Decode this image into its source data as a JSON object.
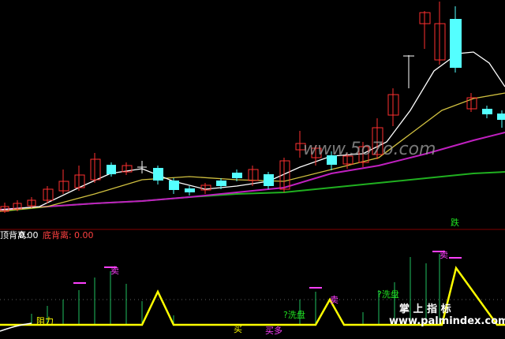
{
  "indicator": {
    "top_label": "顶背离:",
    "top_value": "0.00",
    "bottom_label": "底背离:",
    "bottom_value": "0.00"
  },
  "signals": {
    "fall": "跌",
    "sell_1": "卖",
    "sell_2": "卖",
    "sell_3": "卖",
    "buy": "买",
    "resistance": "阻力",
    "buy_long": "买多",
    "wash_1": "?洗盘",
    "wash_2": "?洗盘"
  },
  "watermarks": {
    "center": "www.5o7o.com",
    "brand": "掌 上 指 标",
    "site": "www.palmindex.com"
  },
  "colors": {
    "background": "#000000",
    "up_candle": "#ff3030",
    "down_candle": "#54ffff",
    "ma_white": "#ffffff",
    "ma_yellow": "#d0c040",
    "ma_magenta": "#c020c0",
    "ma_green": "#20b020",
    "signal_line": "#ffff00",
    "divider": "#800000"
  }
}
